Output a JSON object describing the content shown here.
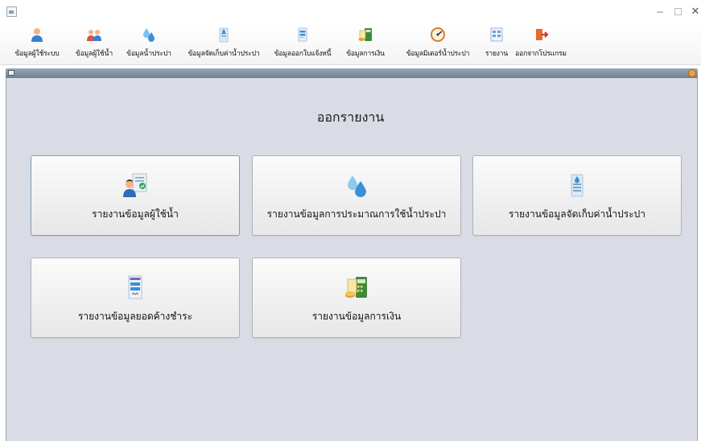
{
  "window": {
    "minimize_glyph": "−",
    "close_glyph": "✕"
  },
  "toolbar": {
    "items": [
      {
        "label": "ข้อมูลผู้ใช้ระบบ",
        "icon": "user-icon"
      },
      {
        "label": "ข้อมูลผู้ใช้น้ำ",
        "icon": "users-group-icon"
      },
      {
        "label": "ข้อมูลน้ำประปา",
        "icon": "water-drops-icon"
      },
      {
        "label": "ข้อมูลจัดเก็บค่าน้ำประปา",
        "icon": "water-bottle-icon"
      },
      {
        "label": "ข้อมูลออกใบแจ้งหนี้",
        "icon": "invoice-icon"
      },
      {
        "label": "ข้อมูลการเงิน",
        "icon": "finance-icon"
      },
      {
        "label": "ข้อมูลมิเตอร์น้ำประปา",
        "icon": "meter-gauge-icon"
      },
      {
        "label": "รายงาน",
        "icon": "report-icon"
      },
      {
        "label": "ออกจากโปรแกรม",
        "icon": "exit-icon"
      }
    ]
  },
  "main": {
    "title": "ออกรายงาน",
    "buttons": [
      {
        "label": "รายงานข้อมูลผู้ใช้น้ำ",
        "icon": "water-user-report-icon"
      },
      {
        "label": "รายงานข้อมูลการประมาณการใช้น้ำประปา",
        "icon": "water-drops-icon"
      },
      {
        "label": "รายงานข้อมูลจัดเก็บค่าน้ำประปา",
        "icon": "water-bottle-icon"
      },
      {
        "label": "รายงานข้อมูลยอดค้างชำระ",
        "icon": "invoice-icon"
      },
      {
        "label": "รายงานข้อมูลการเงิน",
        "icon": "finance-icon"
      }
    ]
  },
  "colors": {
    "desktop_bg": "#d9dce4",
    "frame_bar": "#7d8c9b",
    "water_blue": "#3a8fd6",
    "accent_orange": "#f0a040"
  }
}
